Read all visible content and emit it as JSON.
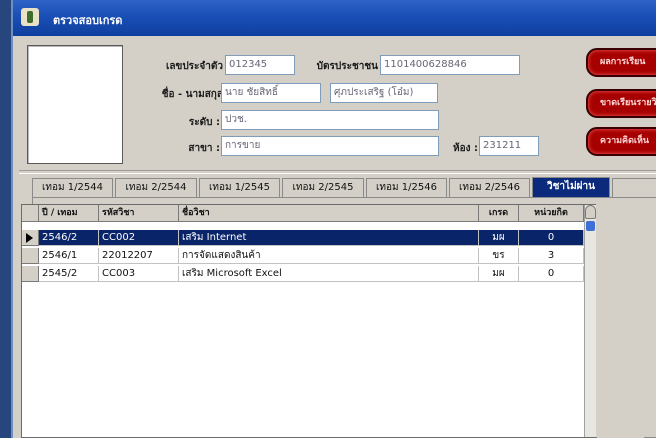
{
  "window": {
    "title": "ตรวจสอบเกรด"
  },
  "form": {
    "student_id_label": "เลขประจำตัว",
    "student_id": "012345",
    "citizen_id_label": "บัตรประชาชน",
    "citizen_id": "1101400628846",
    "name_label": "ชื่อ - นามสกุล",
    "first_name": "นาย ชัยสิทธิ์",
    "last_name": "ศุภประเสริฐ (โอ๋ม)",
    "level_label": "ระดับ :",
    "level": "ปวช.",
    "branch_label": "สาขา :",
    "branch": "การขาย",
    "room_label": "ห้อง :",
    "room": "231211"
  },
  "buttons": {
    "grade_result": "ผลการเรียน",
    "missing_classes": "ขาดเรียนรายวิชา",
    "behavior": "ความคิดเห็น"
  },
  "tabs": [
    "เทอม 1/2544",
    "เทอม 2/2544",
    "เทอม 1/2545",
    "เทอม 2/2545",
    "เทอม 1/2546",
    "เทอม 2/2546",
    "วิชาไม่ผ่าน"
  ],
  "active_tab_index": 6,
  "table": {
    "headers": [
      "ปี / เทอม",
      "รหัสวิชา",
      "ชื่อวิชา",
      "เกรด",
      "หน่วยกิต"
    ],
    "rows": [
      [
        "2546/2",
        "CC002",
        "เสริม Internet",
        "มผ",
        "0"
      ],
      [
        "2546/1",
        "22012207",
        "การจัดแสดงสินค้า",
        "ขร",
        "3"
      ],
      [
        "2545/2",
        "CC003",
        "เสริม Microsoft Excel",
        "มผ",
        "0"
      ]
    ],
    "selected_row_index": 0
  },
  "colors": {
    "title_bar": "#1a4fb7",
    "selection": "#0a246a",
    "red_button": "#a60000",
    "active_tab": "#0b2a7c"
  }
}
